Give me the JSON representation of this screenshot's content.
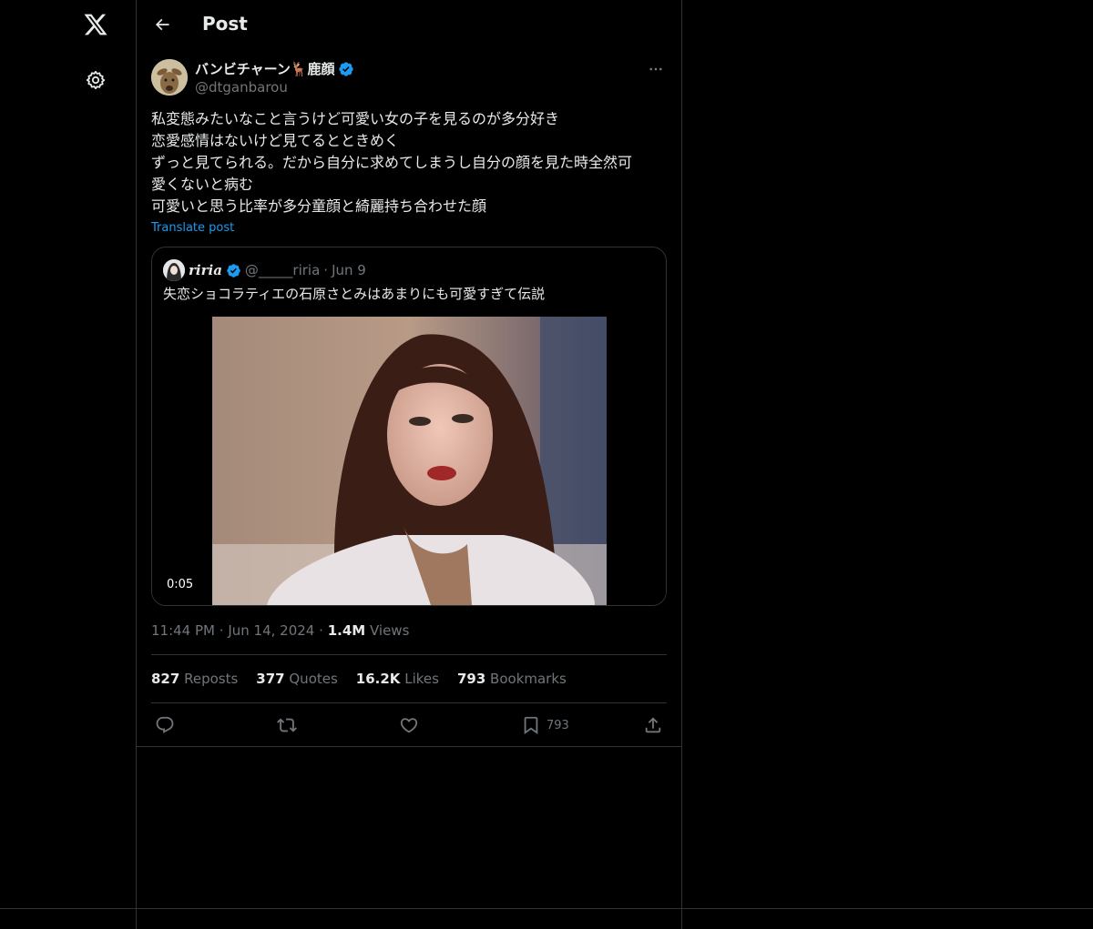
{
  "topbar": {
    "title": "Post"
  },
  "post": {
    "author_name": "バンビチャーン🦌鹿顔",
    "author_handle": "@dtganbarou",
    "text_lines": [
      "私変態みたいなこと言うけど可愛い女の子を見るのが多分好き",
      "恋愛感情はないけど見てるとときめく",
      "ずっと見てられる。だから自分に求めてしまうし自分の顔を見た時全然可",
      "愛くないと病む",
      "可愛いと思う比率が多分童顔と綺麗持ち合わせた顔"
    ],
    "translate_label": "Translate post",
    "time": "11:44 PM",
    "date": "Jun 14, 2024",
    "views_count": "1.4M",
    "views_label": "Views",
    "separator": "·"
  },
  "quote": {
    "name": "riria",
    "handle": "@_____riria",
    "separator": "·",
    "date": "Jun 9",
    "text": "失恋ショコラティエの石原さとみはあまりにも可愛すぎて伝説",
    "video_duration": "0:05"
  },
  "stats": {
    "reposts_count": "827",
    "reposts_label": "Reposts",
    "quotes_count": "377",
    "quotes_label": "Quotes",
    "likes_count": "16.2K",
    "likes_label": "Likes",
    "bookmarks_count": "793",
    "bookmarks_label": "Bookmarks"
  },
  "actions": {
    "bookmark_count": "793"
  },
  "colors": {
    "background": "#000000",
    "border": "#2f3336",
    "accent": "#1d9bf0",
    "muted": "#71767b",
    "text": "#e7e9ea"
  },
  "icons": [
    "x-logo-icon",
    "gear-icon",
    "back-arrow-icon",
    "verified-badge-icon",
    "more-icon",
    "reply-icon",
    "repost-icon",
    "like-icon",
    "bookmark-icon",
    "share-icon"
  ]
}
